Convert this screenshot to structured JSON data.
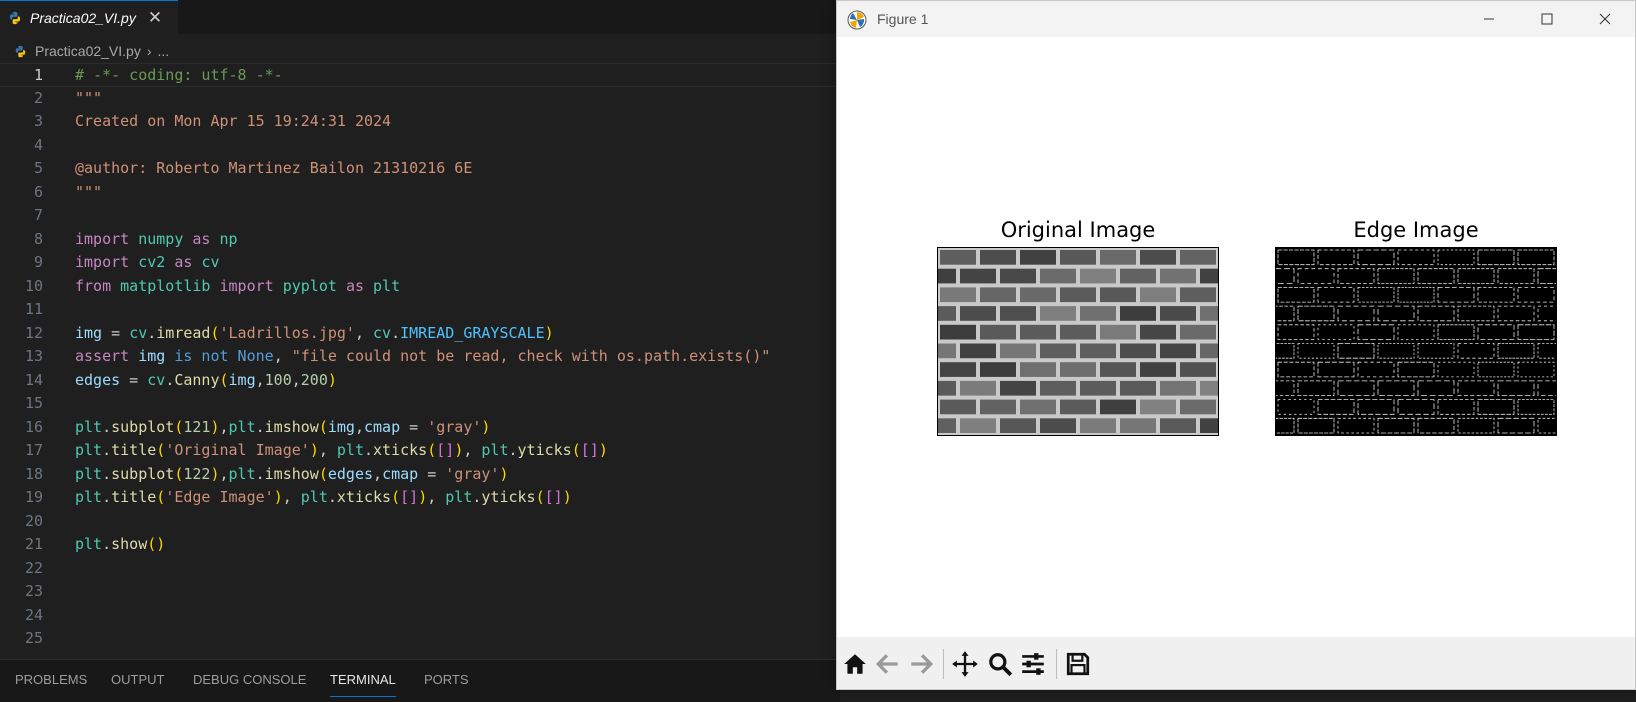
{
  "editor": {
    "tab_label": "Practica02_VI.py",
    "breadcrumb_file": "Practica02_VI.py",
    "breadcrumb_more": "...",
    "line_numbers": [
      "1",
      "2",
      "3",
      "4",
      "5",
      "6",
      "7",
      "8",
      "9",
      "10",
      "11",
      "12",
      "13",
      "14",
      "15",
      "16",
      "17",
      "18",
      "19",
      "20",
      "21",
      "22",
      "23",
      "24",
      "25"
    ],
    "lines": {
      "l1": "# -*- coding: utf-8 -*-",
      "l2": "\"\"\"",
      "l3": "Created on Mon Apr 15 19:24:31 2024",
      "l5": "@author: Roberto Martinez Bailon 21310216 6E",
      "l6": "\"\"\"",
      "l8_kw1": "import",
      "l8_mod": "numpy",
      "l8_kw2": "as",
      "l8_alias": "np",
      "l9_kw1": "import",
      "l9_mod": "cv2",
      "l9_kw2": "as",
      "l9_alias": "cv",
      "l10_kw1": "from",
      "l10_mod": "matplotlib",
      "l10_kw2": "import",
      "l10_sub": "pyplot",
      "l10_kw3": "as",
      "l10_alias": "plt",
      "l12_a": "img",
      "l12_b": " = ",
      "l12_c": "cv",
      "l12_d": ".",
      "l12_e": "imread",
      "l12_f": "(",
      "l12_g": "'Ladrillos.jpg'",
      "l12_h": ", ",
      "l12_i": "cv",
      "l12_j": ".",
      "l12_k": "IMREAD_GRAYSCALE",
      "l12_l": ")",
      "l13_a": "assert",
      "l13_b": " img ",
      "l13_c": "is not",
      "l13_d": " None",
      "l13_e": ", ",
      "l13_f": "\"file could not be read, check with os.path.exists()\"",
      "l14_a": "edges",
      "l14_b": " = ",
      "l14_c": "cv",
      "l14_d": ".",
      "l14_e": "Canny",
      "l14_f": "(",
      "l14_g": "img",
      "l14_h": ",",
      "l14_i": "100",
      "l14_j": ",",
      "l14_k": "200",
      "l14_l": ")",
      "l16_a": "plt",
      "l16_b": ".",
      "l16_c": "subplot",
      "l16_d": "(",
      "l16_e": "121",
      "l16_f": ")",
      "l16_g": ",",
      "l16_h": "plt",
      "l16_i": ".",
      "l16_j": "imshow",
      "l16_k": "(",
      "l16_l": "img",
      "l16_m": ",",
      "l16_n": "cmap",
      "l16_o": " = ",
      "l16_p": "'gray'",
      "l16_q": ")",
      "l17_a": "plt",
      "l17_b": ".",
      "l17_c": "title",
      "l17_d": "(",
      "l17_e": "'Original Image'",
      "l17_f": ")",
      "l17_g": ", ",
      "l17_h": "plt",
      "l17_i": ".",
      "l17_j": "xticks",
      "l17_k": "(",
      "l17_l": "[]",
      "l17_m": ")",
      "l17_n": ", ",
      "l17_o": "plt",
      "l17_p": ".",
      "l17_q": "yticks",
      "l17_r": "(",
      "l17_s": "[]",
      "l17_t": ")",
      "l18_a": "plt",
      "l18_b": ".",
      "l18_c": "subplot",
      "l18_d": "(",
      "l18_e": "122",
      "l18_f": ")",
      "l18_g": ",",
      "l18_h": "plt",
      "l18_i": ".",
      "l18_j": "imshow",
      "l18_k": "(",
      "l18_l": "edges",
      "l18_m": ",",
      "l18_n": "cmap",
      "l18_o": " = ",
      "l18_p": "'gray'",
      "l18_q": ")",
      "l19_a": "plt",
      "l19_b": ".",
      "l19_c": "title",
      "l19_d": "(",
      "l19_e": "'Edge Image'",
      "l19_f": ")",
      "l19_g": ", ",
      "l19_h": "plt",
      "l19_i": ".",
      "l19_j": "xticks",
      "l19_k": "(",
      "l19_l": "[]",
      "l19_m": ")",
      "l19_n": ", ",
      "l19_o": "plt",
      "l19_p": ".",
      "l19_q": "yticks",
      "l19_r": "(",
      "l19_s": "[]",
      "l19_t": ")",
      "l21_a": "plt",
      "l21_b": ".",
      "l21_c": "show",
      "l21_d": "()"
    }
  },
  "panel": {
    "tabs": [
      "PROBLEMS",
      "OUTPUT",
      "DEBUG CONSOLE",
      "TERMINAL",
      "PORTS"
    ],
    "active": "TERMINAL"
  },
  "figure": {
    "window_title": "Figure 1",
    "subplots": [
      {
        "title": "Original Image"
      },
      {
        "title": "Edge Image"
      }
    ],
    "toolbar_icons": [
      "home-icon",
      "back-arrow-icon",
      "forward-arrow-icon",
      "pan-icon",
      "zoom-icon",
      "configure-subplots-icon",
      "save-icon"
    ]
  },
  "colors": {
    "editor_bg": "#1f1f1f",
    "accent": "#0078d4",
    "figure_bg": "#ffffff"
  }
}
